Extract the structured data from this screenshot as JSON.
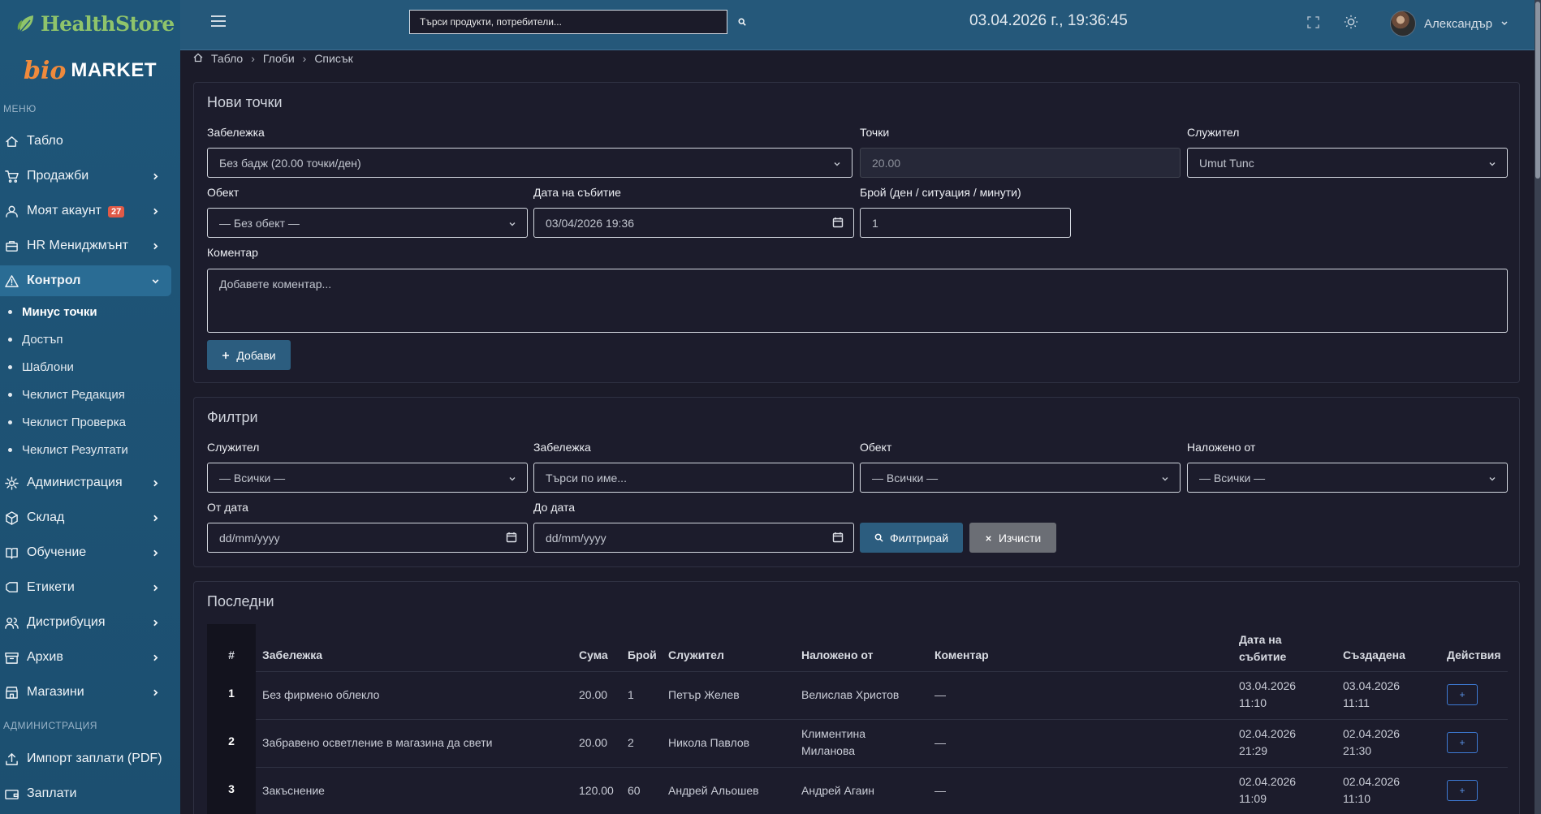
{
  "brand": {
    "name": "HealthStore",
    "bio_logo": "bio",
    "market_logo": "MARKET"
  },
  "sidebar": {
    "menu_label": "МЕНЮ",
    "admin_label": "АДМИНИСТРАЦИЯ",
    "items": [
      {
        "label": "Табло",
        "icon": "home-icon"
      },
      {
        "label": "Продажби",
        "icon": "cart-icon"
      },
      {
        "label": "Моят акаунт",
        "icon": "user-icon",
        "badge": "27"
      },
      {
        "label": "HR Мениджмънт",
        "icon": "briefcase-icon"
      },
      {
        "label": "Контрол",
        "icon": "warning-icon"
      },
      {
        "label": "Администрация",
        "icon": "gear-icon"
      },
      {
        "label": "Склад",
        "icon": "box-icon"
      },
      {
        "label": "Обучение",
        "icon": "book-icon"
      },
      {
        "label": "Етикети",
        "icon": "tag-icon"
      },
      {
        "label": "Дистрибуция",
        "icon": "users-icon"
      },
      {
        "label": "Архив",
        "icon": "archive-icon"
      },
      {
        "label": "Магазини",
        "icon": "store-icon"
      }
    ],
    "subitems": [
      {
        "label": "Минус точки"
      },
      {
        "label": "Достъп"
      },
      {
        "label": "Шаблони"
      },
      {
        "label": "Чеклист Редакция"
      },
      {
        "label": "Чеклист Проверка"
      },
      {
        "label": "Чеклист Резултати"
      }
    ],
    "admin_items": [
      {
        "label": "Импорт заплати (PDF)",
        "icon": "upload-icon"
      },
      {
        "label": "Заплати",
        "icon": "wallet-icon"
      }
    ]
  },
  "topbar": {
    "search_placeholder": "Търси продукти, потребители...",
    "datetime": "03.04.2026 г., 19:36:45",
    "user_name": "Александър"
  },
  "breadcrumb": [
    "Табло",
    "Глоби",
    "Списък"
  ],
  "new_points": {
    "title": "Нови точки",
    "remark_label": "Забележка",
    "remark_value": "Без бадж (20.00 точки/ден)",
    "points_label": "Точки",
    "points_value": "20.00",
    "employee_label": "Служител",
    "employee_value": "Umut Tunc",
    "object_label": "Обект",
    "object_value": "— Без обект —",
    "date_label": "Дата на събитие",
    "date_value": "03/04/2026 19:36",
    "count_label": "Брой (ден / ситуация / минути)",
    "count_value": "1",
    "comment_label": "Коментар",
    "comment_placeholder": "Добавете коментар...",
    "add_button": "Добави"
  },
  "filters": {
    "title": "Филтри",
    "employee_label": "Служител",
    "employee_value": "— Всички —",
    "remark_label": "Забележка",
    "remark_placeholder": "Търси по име...",
    "object_label": "Обект",
    "object_value": "— Всички —",
    "imposed_label": "Наложено от",
    "imposed_value": "— Всички —",
    "from_label": "От дата",
    "from_value": "dd/mm/yyyy",
    "to_label": "До дата",
    "to_value": "dd/mm/yyyy",
    "filter_button": "Филтрирай",
    "clear_button": "Изчисти"
  },
  "recent": {
    "title": "Последни",
    "columns": [
      "#",
      "Забележка",
      "Сума",
      "Брой",
      "Служител",
      "Наложено от",
      "Коментар",
      "Дата на",
      "събитие",
      "Създадена",
      "Действия"
    ],
    "rows": [
      {
        "n": "1",
        "remark": "Без фирмено облекло",
        "sum": "20.00",
        "count": "1",
        "employee": "Петър Желев",
        "imposed1": "Велислав Христов",
        "imposed2": "",
        "comment": "—",
        "date1": "03.04.2026",
        "date2": "11:10",
        "created1": "03.04.2026",
        "created2": "11:11",
        "action": "+"
      },
      {
        "n": "2",
        "remark": "Забравено осветление в магазина да свети",
        "sum": "20.00",
        "count": "2",
        "employee": "Никола Павлов",
        "imposed1": "Климентина",
        "imposed2": "Миланова",
        "comment": "—",
        "date1": "02.04.2026",
        "date2": "21:29",
        "created1": "02.04.2026",
        "created2": "21:30",
        "action": "+"
      },
      {
        "n": "3",
        "remark": "Закъснение",
        "sum": "120.00",
        "count": "60",
        "employee": "Андрей Альошев",
        "imposed1": "Андрей Агаин",
        "imposed2": "",
        "comment": "—",
        "date1": "02.04.2026",
        "date2": "11:09",
        "created1": "02.04.2026",
        "created2": "11:10",
        "action": "+"
      }
    ]
  }
}
